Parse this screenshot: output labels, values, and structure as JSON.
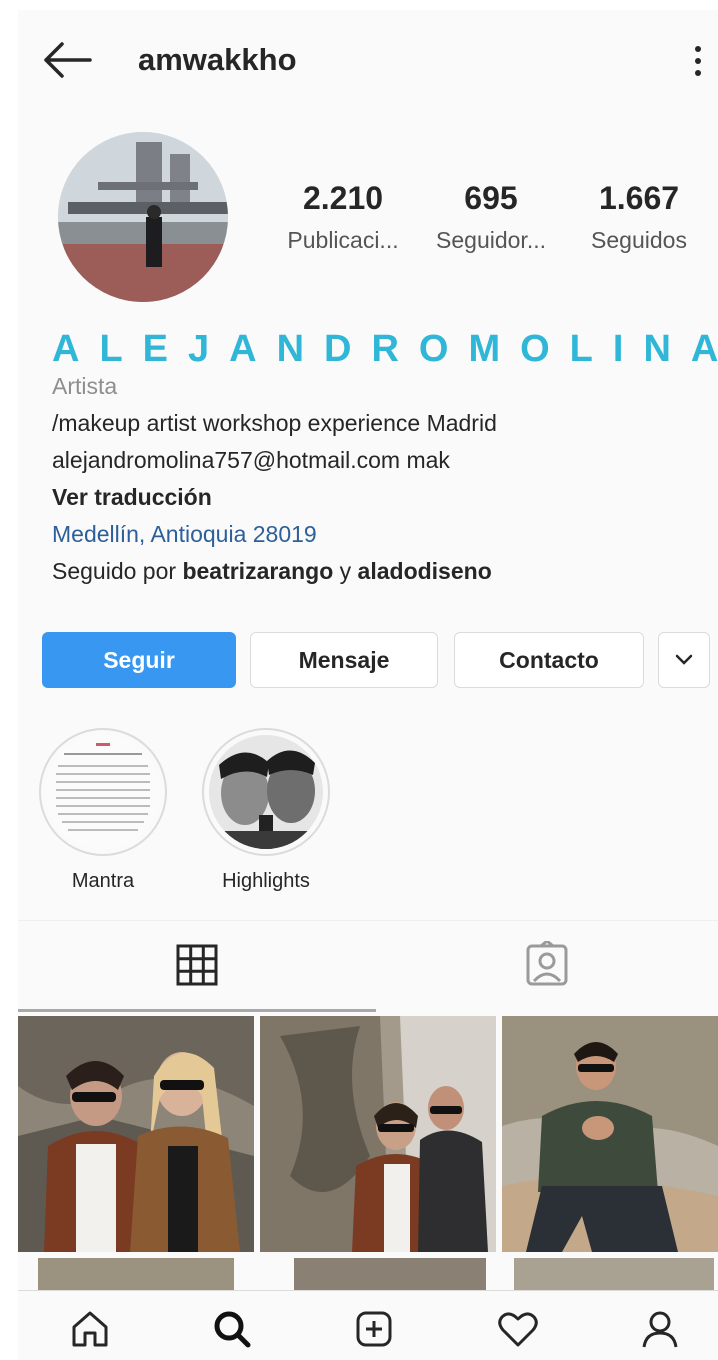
{
  "header": {
    "username": "amwakkho"
  },
  "stats": [
    {
      "value": "2.210",
      "label": "Publicaci..."
    },
    {
      "value": "695",
      "label": "Seguidor..."
    },
    {
      "value": "1.667",
      "label": "Seguidos"
    }
  ],
  "profile": {
    "display_name": "ALEJANDROMOLINA",
    "category": "Artista",
    "bio_line1": "/makeup artist  workshop experience Madrid",
    "bio_line2": "alejandromolina757@hotmail.com mak",
    "see_translation": "Ver traducción",
    "location": "Medellín, Antioquia 28019",
    "followed_by_prefix": "Seguido por",
    "followed_by_user1": "beatrizarango",
    "followed_by_conj": "y",
    "followed_by_user2": "aladodiseno"
  },
  "actions": {
    "follow": "Seguir",
    "message": "Mensaje",
    "contact": "Contacto"
  },
  "highlights": [
    {
      "label": "Mantra"
    },
    {
      "label": "Highlights"
    }
  ],
  "tabs": [
    {
      "icon": "grid-icon",
      "active": true
    },
    {
      "icon": "tagged-icon",
      "active": false
    }
  ],
  "bottom_nav": [
    "home-icon",
    "search-icon",
    "add-icon",
    "heart-icon",
    "profile-icon"
  ],
  "colors": {
    "accent": "#3897f0",
    "display_name": "#30b6d6",
    "location": "#2d5f9a"
  }
}
